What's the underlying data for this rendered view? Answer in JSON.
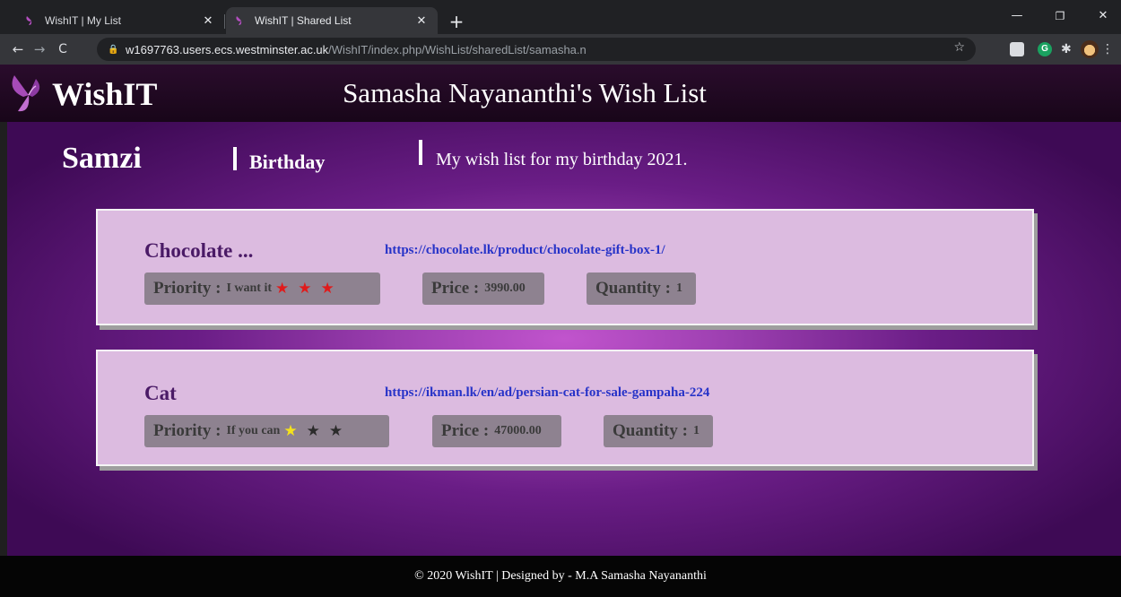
{
  "browser": {
    "tabs": [
      {
        "title": "WishIT | My List",
        "active": false
      },
      {
        "title": "WishIT | Shared List",
        "active": true
      }
    ],
    "new_tab": "+",
    "url_host": "w1697763.users.ecs.westminster.ac.uk",
    "url_path": "/WishIT/index.php/WishList/sharedList/samasha.n"
  },
  "header": {
    "logo_text": "WishIT",
    "page_title": "Samasha Nayananthi's Wish List"
  },
  "list": {
    "owner": "Samzi",
    "occasion": "Birthday",
    "description": "My wish list for my birthday 2021."
  },
  "items": [
    {
      "name": "Chocolate ...",
      "link": "https://chocolate.lk/product/chocolate-gift-box-1/",
      "priority_label": "Priority :",
      "priority_text": "I want it",
      "priority_stars": 3,
      "price_label": "Price :",
      "price": "3990.00",
      "quantity_label": "Quantity :",
      "quantity": "1"
    },
    {
      "name": "Cat",
      "link": "https://ikman.lk/en/ad/persian-cat-for-sale-gampaha-224",
      "priority_label": "Priority :",
      "priority_text": "If you can",
      "priority_stars": 1,
      "price_label": "Price :",
      "price": "47000.00",
      "quantity_label": "Quantity :",
      "quantity": "1"
    }
  ],
  "footer": {
    "text": "© 2020 WishIT | Designed by - M.A Samasha Nayananthi"
  },
  "colors": {
    "star_high": "#e01b1b",
    "star_low": "#f5e21b",
    "star_off": "#2b2b2b"
  }
}
